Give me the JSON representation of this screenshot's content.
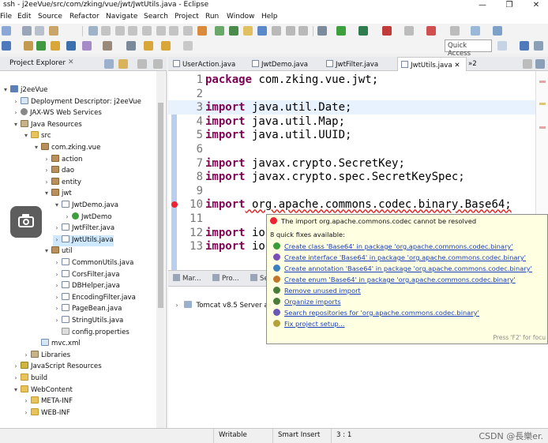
{
  "window": {
    "title": "ssh - j2eeVue/src/com/zking/vue/jwt/JwtUtils.java - Eclipse",
    "controls": [
      "—",
      "❐",
      "✕"
    ]
  },
  "menu": [
    "File",
    "Edit",
    "Source",
    "Refactor",
    "Navigate",
    "Search",
    "Project",
    "Run",
    "Window",
    "Help"
  ],
  "toolbar": {
    "quick_access_placeholder": "Quick Access"
  },
  "explorer": {
    "title": "Project Explorer",
    "close": "✕",
    "tree": [
      {
        "label": "j2eeVue",
        "arrow": "▾",
        "icon": "project",
        "level": 0
      },
      {
        "label": "Deployment Descriptor: j2eeVue",
        "arrow": "›",
        "icon": "xml",
        "level": 1
      },
      {
        "label": "JAX-WS Web Services",
        "arrow": "›",
        "icon": "gear",
        "level": 1
      },
      {
        "label": "Java Resources",
        "arrow": "▾",
        "icon": "lib",
        "level": 1
      },
      {
        "label": "src",
        "arrow": "▾",
        "icon": "folder",
        "level": 2
      },
      {
        "label": "com.zking.vue",
        "arrow": "▾",
        "icon": "package",
        "level": 3
      },
      {
        "label": "action",
        "arrow": "›",
        "icon": "package",
        "level": 4
      },
      {
        "label": "dao",
        "arrow": "›",
        "icon": "package",
        "level": 4
      },
      {
        "label": "entity",
        "arrow": "›",
        "icon": "package",
        "level": 4
      },
      {
        "label": "jwt",
        "arrow": "▾",
        "icon": "package",
        "level": 4
      },
      {
        "label": "JwtDemo.java",
        "arrow": "▾",
        "icon": "java",
        "level": 5
      },
      {
        "label": "JwtDemo",
        "arrow": "›",
        "icon": "class",
        "level": 6
      },
      {
        "label": "JwtFilter.java",
        "arrow": "›",
        "icon": "java",
        "level": 5
      },
      {
        "label": "JwtUtils.java",
        "arrow": "›",
        "icon": "java",
        "level": 5,
        "selected": true
      },
      {
        "label": "util",
        "arrow": "▾",
        "icon": "package",
        "level": 4
      },
      {
        "label": "CommonUtils.java",
        "arrow": "›",
        "icon": "java",
        "level": 5
      },
      {
        "label": "CorsFilter.java",
        "arrow": "›",
        "icon": "java",
        "level": 5
      },
      {
        "label": "DBHelper.java",
        "arrow": "›",
        "icon": "java",
        "level": 5
      },
      {
        "label": "EncodingFilter.java",
        "arrow": "›",
        "icon": "java",
        "level": 5
      },
      {
        "label": "PageBean.java",
        "arrow": "›",
        "icon": "java",
        "level": 5
      },
      {
        "label": "StringUtils.java",
        "arrow": "›",
        "icon": "java",
        "level": 5
      },
      {
        "label": "config.properties",
        "arrow": "",
        "icon": "prop",
        "level": 5
      },
      {
        "label": "mvc.xml",
        "arrow": "",
        "icon": "xml",
        "level": 3
      },
      {
        "label": "Libraries",
        "arrow": "›",
        "icon": "lib",
        "level": 2
      },
      {
        "label": "JavaScript Resources",
        "arrow": "›",
        "icon": "js",
        "level": 1
      },
      {
        "label": "build",
        "arrow": "›",
        "icon": "folder",
        "level": 1
      },
      {
        "label": "WebContent",
        "arrow": "▾",
        "icon": "web",
        "level": 1
      },
      {
        "label": "META-INF",
        "arrow": "›",
        "icon": "folder",
        "level": 2
      },
      {
        "label": "WEB-INF",
        "arrow": "›",
        "icon": "folder",
        "level": 2
      }
    ]
  },
  "editor": {
    "tabs": [
      {
        "label": "UserAction.java",
        "active": false
      },
      {
        "label": "JwtDemo.java",
        "active": false
      },
      {
        "label": "JwtFilter.java",
        "active": false
      },
      {
        "label": "JwtUtils.java",
        "active": true,
        "close": "✕"
      }
    ],
    "overflow": "»2",
    "lines": [
      {
        "n": "1",
        "kw": "package",
        "rest": " com.zking.vue.jwt;"
      },
      {
        "n": "2",
        "kw": "",
        "rest": ""
      },
      {
        "n": "3",
        "kw": "import",
        "rest": " java.util.Date;",
        "current": true
      },
      {
        "n": "4",
        "kw": "import",
        "rest": " java.util.Map;"
      },
      {
        "n": "5",
        "kw": "import",
        "rest": " java.util.UUID;"
      },
      {
        "n": "6",
        "kw": "",
        "rest": ""
      },
      {
        "n": "7",
        "kw": "import",
        "rest": " javax.crypto.SecretKey;"
      },
      {
        "n": "8",
        "kw": "import",
        "rest": " javax.crypto.spec.SecretKeySpec;"
      },
      {
        "n": "9",
        "kw": "",
        "rest": ""
      },
      {
        "n": "10",
        "kw": "import",
        "rest": " org.apache.commons.codec.binary.Base64;",
        "error": true
      },
      {
        "n": "11",
        "kw": "",
        "rest": ""
      },
      {
        "n": "12",
        "kw": "import",
        "rest": " io"
      },
      {
        "n": "13",
        "kw": "import",
        "rest": " io"
      }
    ]
  },
  "bottom_panel": {
    "tabs": [
      "Mar...",
      "Pro...",
      "Se"
    ],
    "server": "Tomcat v8.5 Server a"
  },
  "quick_fix": {
    "header": "The import org.apache.commons.codec cannot be resolved",
    "count": "8 quick fixes available:",
    "items": [
      {
        "label": "Create class 'Base64' in package 'org.apache.commons.codec.binary'",
        "color": "#3a9b3a"
      },
      {
        "label": "Create interface 'Base64' in package 'org.apache.commons.codec.binary'",
        "color": "#7a4fb8"
      },
      {
        "label": "Create annotation 'Base64' in package 'org.apache.commons.codec.binary'",
        "color": "#3a7fbf"
      },
      {
        "label": "Create enum 'Base64' in package 'org.apache.commons.codec.binary'",
        "color": "#c2762a"
      },
      {
        "label": "Remove unused import",
        "color": "#4a7d3a"
      },
      {
        "label": "Organize imports",
        "color": "#4a7d3a"
      },
      {
        "label": "Search repositories for 'org.apache.commons.codec.binary'",
        "color": "#6a58b8"
      },
      {
        "label": "Fix project setup...",
        "color": "#b5a03a"
      }
    ],
    "footer": "Press 'F2' for focu"
  },
  "status": {
    "writable": "Writable",
    "insert_mode": "Smart Insert",
    "position": "3 : 1"
  },
  "watermark": "CSDN @長樂er."
}
